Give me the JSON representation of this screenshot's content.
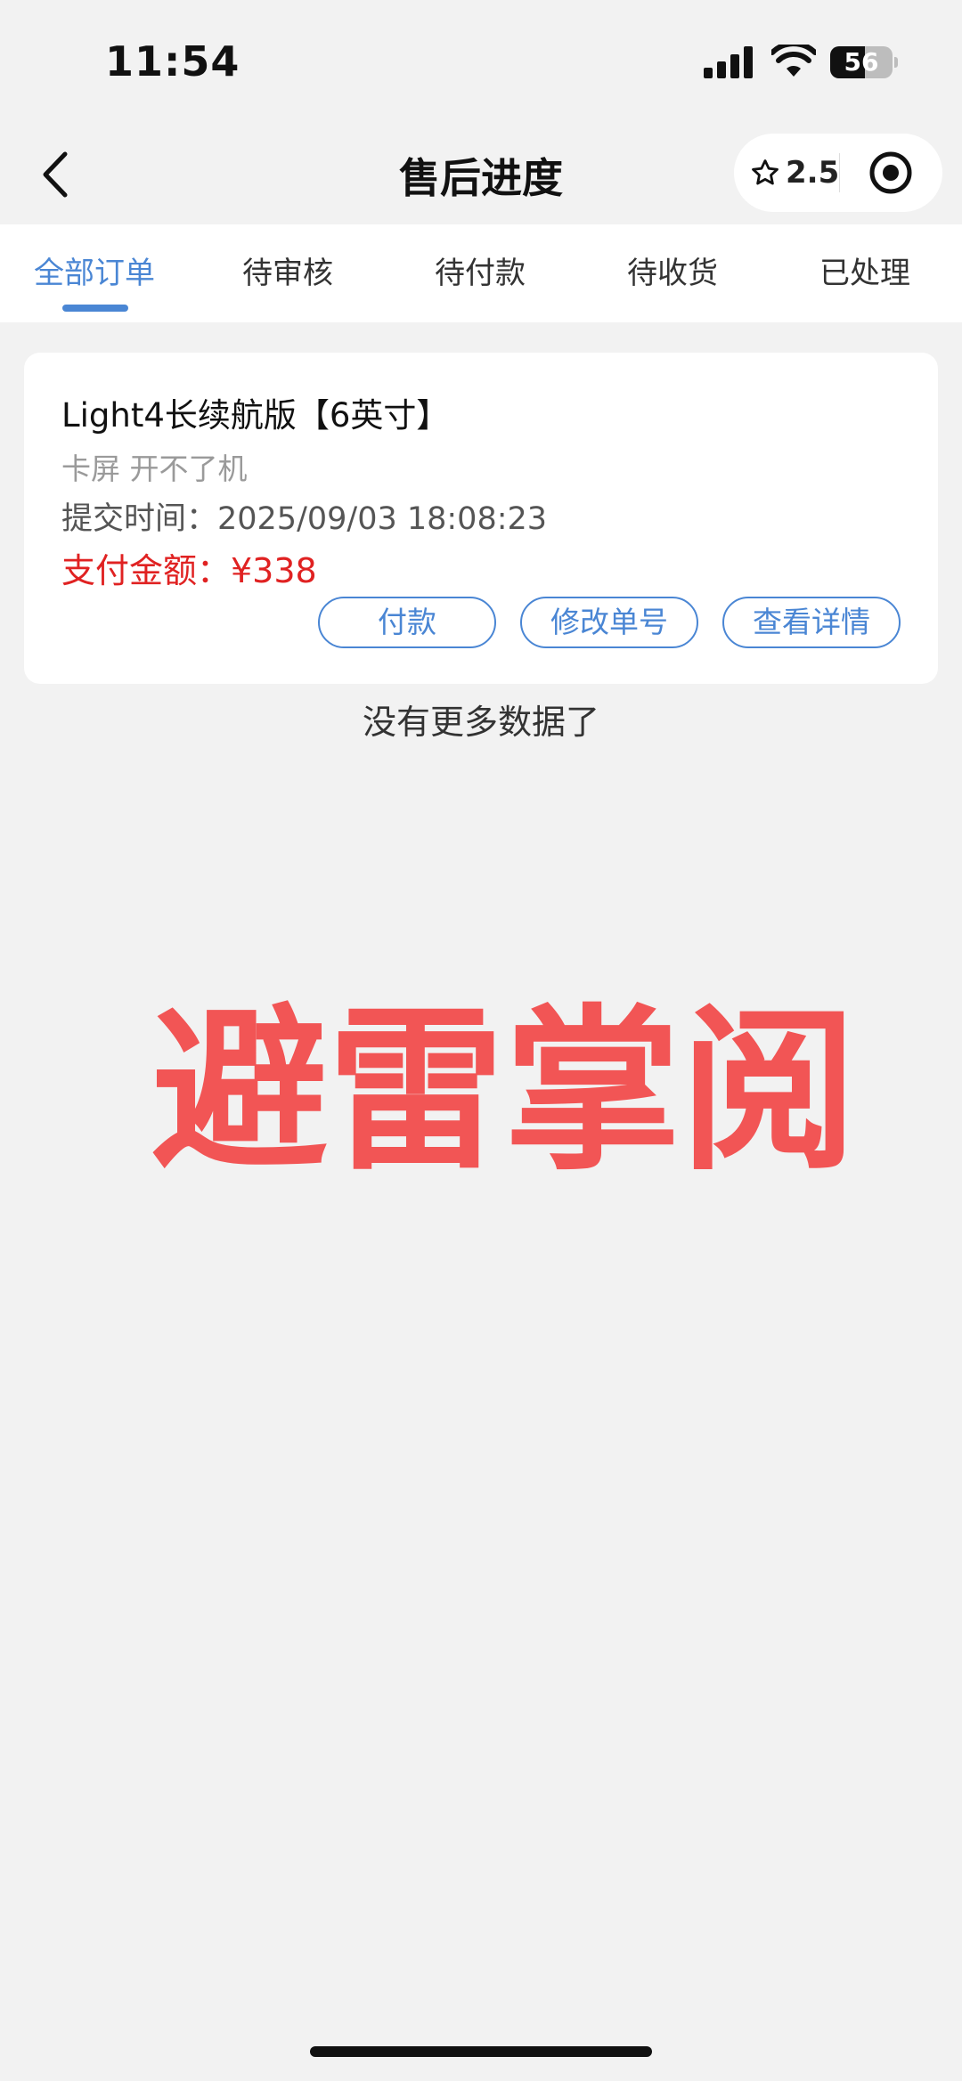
{
  "status_bar": {
    "time": "11:54",
    "battery": "56",
    "battery_level": 0.56
  },
  "nav": {
    "title": "售后进度",
    "rating": "2.5"
  },
  "tabs": [
    {
      "label": "全部订单",
      "active": true
    },
    {
      "label": "待审核",
      "active": false
    },
    {
      "label": "待付款",
      "active": false
    },
    {
      "label": "待收货",
      "active": false
    },
    {
      "label": "已处理",
      "active": false
    }
  ],
  "order": {
    "title": "Light4长续航版【6英寸】",
    "description": "卡屏 开不了机",
    "submit_time_label": "提交时间：2025/09/03 18:08:23",
    "amount_label": "支付金额：¥338",
    "buttons": {
      "pay": "付款",
      "edit_tracking": "修改单号",
      "view_details": "查看详情"
    }
  },
  "list_end_text": "没有更多数据了",
  "watermark": "避雷掌阅",
  "colors": {
    "accent": "#4a86d4",
    "amount": "#e02222",
    "watermark": "#f25555",
    "background": "#f2f2f2"
  }
}
